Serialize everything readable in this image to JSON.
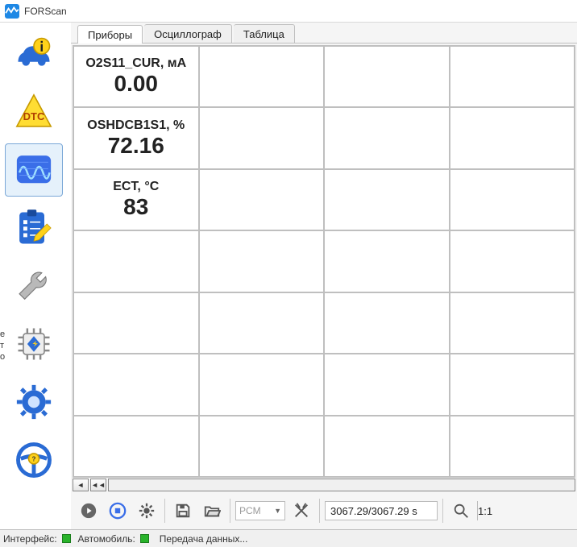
{
  "app": {
    "title": "FORScan"
  },
  "side_tools": [
    {
      "name": "vehicle-info"
    },
    {
      "name": "dtc"
    },
    {
      "name": "oscilloscope"
    },
    {
      "name": "checklist"
    },
    {
      "name": "wrench"
    },
    {
      "name": "chip"
    },
    {
      "name": "gear"
    },
    {
      "name": "steering"
    }
  ],
  "tabs": [
    {
      "label": "Приборы",
      "active": true
    },
    {
      "label": "Осциллограф",
      "active": false
    },
    {
      "label": "Таблица",
      "active": false
    }
  ],
  "gauges": [
    {
      "label": "O2S11_CUR, мА",
      "value": "0.00"
    },
    {
      "label": "OSHDCB1S1, %",
      "value": "72.16"
    },
    {
      "label": "ECT, °C",
      "value": "83"
    }
  ],
  "bottom": {
    "combo_label": "PCM",
    "time_display": "3067.29/3067.29 s",
    "zoom": "1:1"
  },
  "status": {
    "interface_label": "Интерфейс:",
    "vehicle_label": "Автомобиль:",
    "transfer_label": "Передача данных..."
  }
}
